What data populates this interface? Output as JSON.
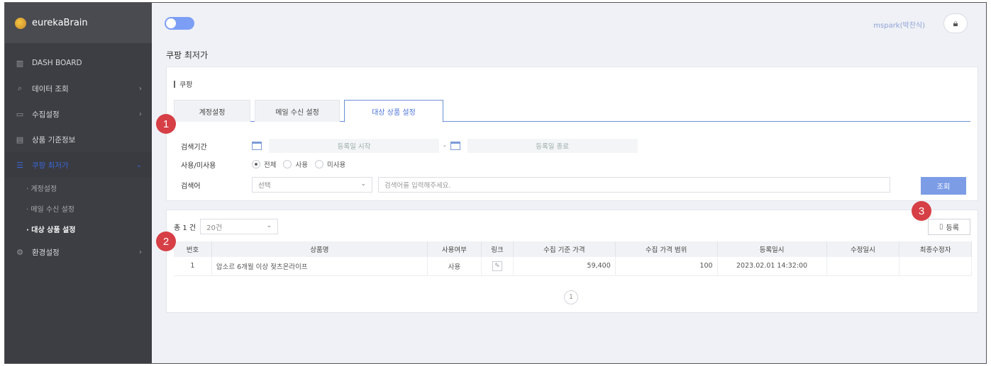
{
  "brand": {
    "name": "eurekaBrain"
  },
  "sidebar": {
    "items": [
      {
        "label": "DASH BOARD",
        "icon": "bar-chart-icon"
      },
      {
        "label": "데이터 조회",
        "icon": "search-icon"
      },
      {
        "label": "수집설정",
        "icon": "settings-icon"
      },
      {
        "label": "상품 기준정보",
        "icon": "document-icon"
      },
      {
        "label": "쿠팡 최저가",
        "icon": "list-icon"
      },
      {
        "label": "환경설정",
        "icon": "gear-icon"
      }
    ],
    "subitems": [
      "· 계정설정",
      "· 메일 수신 설정",
      "· 대상 상품 설정"
    ]
  },
  "header": {
    "user": "mspark(박찬식)",
    "page_title": "쿠팡 최저가"
  },
  "filter": {
    "crumb": "쿠팡",
    "tabs": [
      "계정설정",
      "메일 수신 설정",
      "대상 상품 설정"
    ],
    "date_label": "검색기간",
    "date_start_placeholder": "등록일 시작",
    "date_end_placeholder": "등록일 종료",
    "date_sep": "-",
    "use_label": "사용/미사용",
    "radio_all": "전체",
    "radio_used": "사용",
    "radio_unused": "미사용",
    "keyword_label": "검색어",
    "select_value": "선택",
    "keyword_placeholder": "검색어를 입력해주세요.",
    "search_button": "조회"
  },
  "result": {
    "total_label": "총 1 건",
    "page_size": "20건",
    "register_button": "등록",
    "columns": [
      "번호",
      "상품명",
      "사용여부",
      "링크",
      "수집 기준 가격",
      "수집 가격 범위",
      "등록일시",
      "수정일시",
      "최종수정자"
    ],
    "rows": [
      {
        "no": "1",
        "name": "압소르 6개월 이상 젖츠온라이프",
        "use": "사용",
        "base_price": "59,400",
        "range": "100",
        "created": "2023.02.01 14:32:00",
        "modified": "",
        "modifier": ""
      }
    ],
    "page": "1"
  },
  "markers": [
    "1",
    "2",
    "3"
  ],
  "colors": {
    "sidebar": "#3d3e43",
    "accent": "#3a66d8",
    "button": "#7c9de6",
    "marker": "#d63f45"
  }
}
